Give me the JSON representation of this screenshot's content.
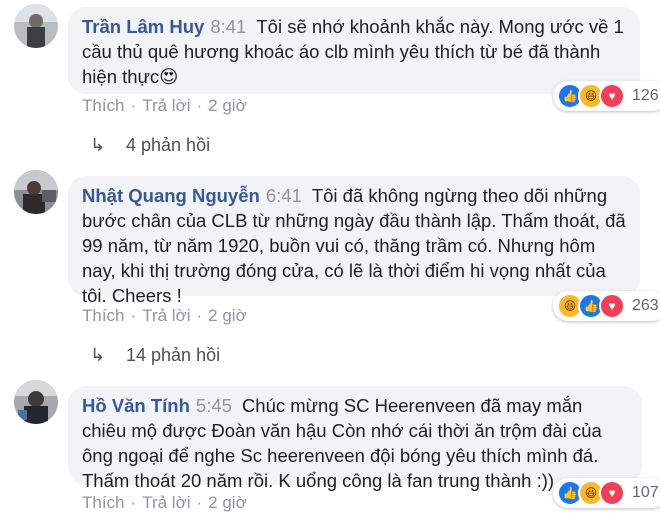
{
  "comments": [
    {
      "author": "Trần Lâm Huy",
      "time": "8:41",
      "text": "Tôi sẽ nhớ khoảnh khắc này. Mong ước về 1 cầu thủ quê hương khoác áo clb mình yêu thích từ bé đã thành hiện thực😍",
      "like": "Thích",
      "reply": "Trả lời",
      "age": "2 giờ",
      "reaction_count": "126",
      "reactions": [
        "like-icon",
        "haha-icon",
        "love-icon"
      ],
      "replies": "4 phản hồi"
    },
    {
      "author": "Nhật Quang Nguyễn",
      "time": "6:41",
      "text": "Tôi đã không ngừng theo dõi những bước chân của CLB từ những ngày đầu thành lập. Thấm thoát, đã 99 năm, từ năm 1920, buồn vui có, thăng trầm có. Nhưng hôm nay, khi thị trường đóng cửa, có lẽ là thời điểm hi vọng nhất của tôi. Cheers !",
      "like": "Thích",
      "reply": "Trả lời",
      "age": "2 giờ",
      "reaction_count": "263",
      "reactions": [
        "haha-icon",
        "like-icon",
        "love-icon"
      ],
      "replies": "14 phản hồi"
    },
    {
      "author": "Hồ Văn Tính",
      "time": "5:45",
      "text": "Chúc mừng SC Heerenveen đã may mắn chiêu mộ được Đoàn văn hậu Còn nhớ cái thời ăn trộm đài của ông ngoại để nghe Sc heerenveen đội bóng yêu thích mình đá. Thấm thoát 20 năm rồi. K uổng công là fan trung thành :))",
      "like": "Thích",
      "reply": "Trả lời",
      "age": "2 giờ",
      "reaction_count": "107",
      "reactions": [
        "like-icon",
        "haha-icon",
        "love-icon"
      ]
    }
  ],
  "colors": {
    "author": "#385898",
    "bubble": "#f2f3f5",
    "meta": "#90949c",
    "like": "#1877f2",
    "haha": "#f7b928",
    "love": "#f33e58"
  }
}
